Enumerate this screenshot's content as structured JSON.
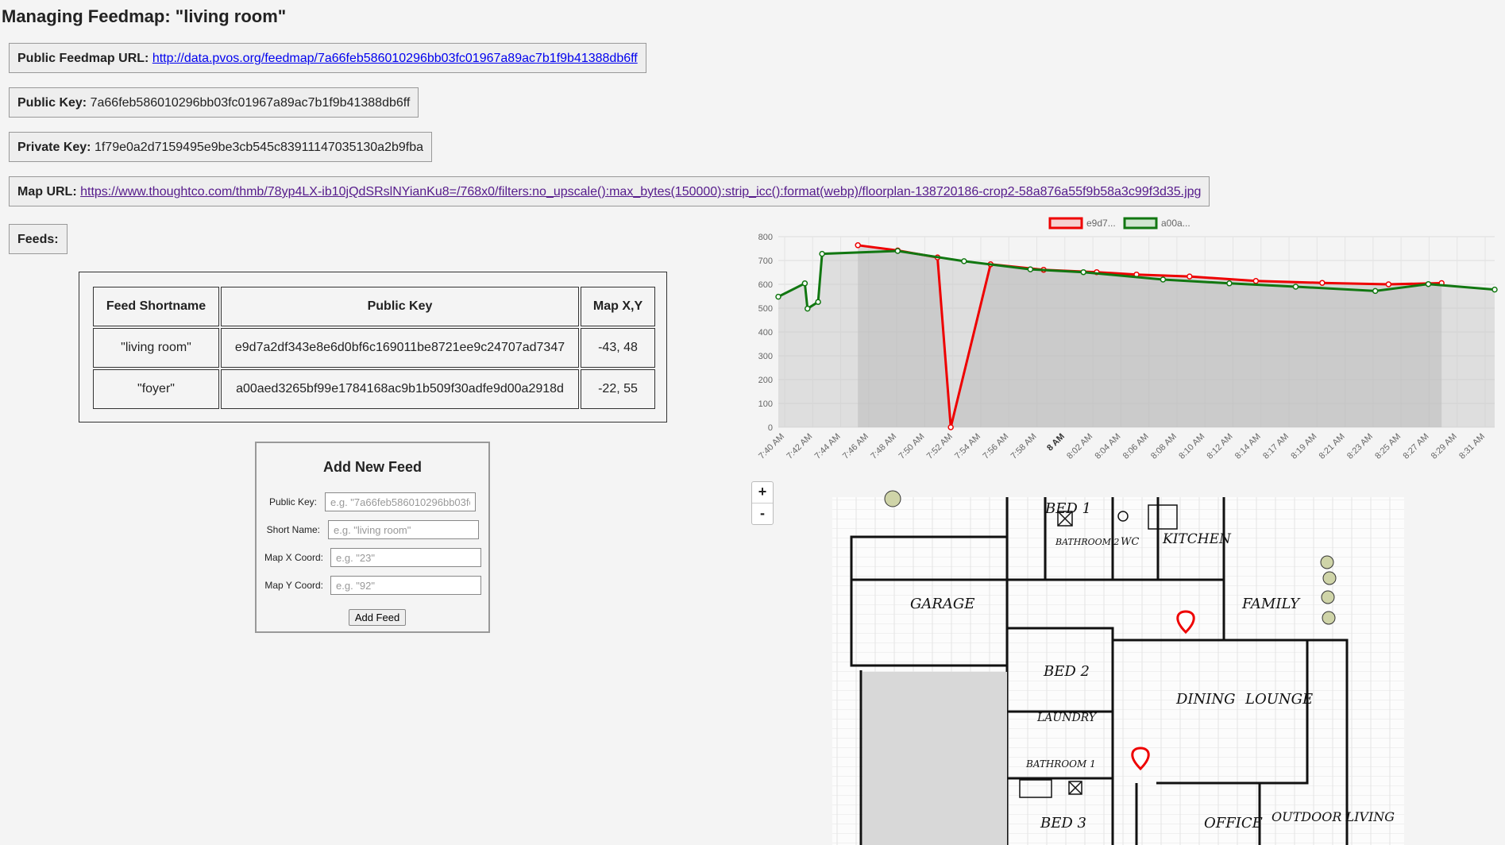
{
  "page_title": "Managing Feedmap: \"living room\"",
  "public_url": {
    "label": "Public Feedmap URL:",
    "value": "http://data.pvos.org/feedmap/7a66feb586010296bb03fc01967a89ac7b1f9b41388db6ff"
  },
  "public_key": {
    "label": "Public Key:",
    "value": "7a66feb586010296bb03fc01967a89ac7b1f9b41388db6ff"
  },
  "private_key": {
    "label": "Private Key:",
    "value": "1f79e0a2d7159495e9be3cb545c83911147035130a2b9fba"
  },
  "map_url": {
    "label": "Map URL:",
    "value": "https://www.thoughtco.com/thmb/78yp4LX-ib10jQdSRslNYianKu8=/768x0/filters:no_upscale():max_bytes(150000):strip_icc():format(webp)/floorplan-138720186-crop2-58a876a55f9b58a3c99f3d35.jpg"
  },
  "feeds_label": "Feeds:",
  "table": {
    "headers": [
      "Feed Shortname",
      "Public Key",
      "Map X,Y"
    ],
    "rows": [
      [
        "\"living room\"",
        "e9d7a2df343e8e6d0bf6c169011be8721ee9c24707ad7347",
        "-43, 48"
      ],
      [
        "\"foyer\"",
        "a00aed3265bf99e1784168ac9b1b509f30adfe9d00a2918d",
        "-22, 55"
      ]
    ]
  },
  "add_feed": {
    "title": "Add New Feed",
    "public_key_label": "Public Key:",
    "public_key_placeholder": "e.g. \"7a66feb586010296bb03fc01967a89ac7b1f9b41388db6ff\"",
    "short_name_label": "Short Name:",
    "short_name_placeholder": "e.g. \"living room\"",
    "x_label": "Map X Coord:",
    "x_placeholder": "e.g. \"23\"",
    "y_label": "Map Y Coord:",
    "y_placeholder": "e.g. \"92\"",
    "button": "Add Feed"
  },
  "map": {
    "zoom_in": "+",
    "zoom_out": "-",
    "rooms": [
      "BED 1",
      "BATHROOM 2",
      "WC",
      "KITCHEN",
      "GARAGE",
      "FAMILY",
      "BED 2",
      "DINING",
      "LOUNGE",
      "LAUNDRY",
      "BATHROOM 1",
      "BED 3",
      "OFFICE",
      "OUTDOOR LIVING"
    ]
  },
  "chart_data": {
    "type": "line",
    "ylim": [
      0,
      800
    ],
    "yticks": [
      0,
      100,
      200,
      300,
      400,
      500,
      600,
      700,
      800
    ],
    "x_range": [
      "7:39 AM",
      "8:33 AM"
    ],
    "xtick_labels": [
      "7:40 AM",
      "7:42 AM",
      "7:44 AM",
      "7:46 AM",
      "7:48 AM",
      "7:50 AM",
      "7:52 AM",
      "7:54 AM",
      "7:56 AM",
      "7:58 AM",
      "8 AM",
      "8:02 AM",
      "8:04 AM",
      "8:06 AM",
      "8:08 AM",
      "8:10 AM",
      "8:12 AM",
      "8:14 AM",
      "8:17 AM",
      "8:19 AM",
      "8:21 AM",
      "8:23 AM",
      "8:25 AM",
      "8:27 AM",
      "8:29 AM",
      "8:31 AM"
    ],
    "grid": true,
    "legend": "top-center",
    "series": [
      {
        "name": "e9d7...",
        "color": "#ee0000",
        "x": [
          "7:45 AM",
          "7:48 AM",
          "7:51 AM",
          "7:52 AM",
          "7:55 AM",
          "7:59 AM",
          "8:03 AM",
          "8:06 AM",
          "8:10 AM",
          "8:15 AM",
          "8:20 AM",
          "8:25 AM",
          "8:29 AM"
        ],
        "values": [
          764,
          742,
          713,
          0,
          684,
          661,
          651,
          641,
          633,
          614,
          606,
          600,
          605
        ]
      },
      {
        "name": "a00a...",
        "color": "#117711",
        "x": [
          "7:39 AM",
          "7:41 AM",
          "7:41.2 AM",
          "7:42 AM",
          "7:42.3 AM",
          "7:48 AM",
          "7:53 AM",
          "7:58 AM",
          "8:02 AM",
          "8:08 AM",
          "8:13 AM",
          "8:18 AM",
          "8:24 AM",
          "8:28 AM",
          "8:33 AM"
        ],
        "values": [
          548,
          604,
          498,
          526,
          728,
          740,
          697,
          663,
          651,
          620,
          604,
          590,
          572,
          601,
          578
        ]
      }
    ]
  }
}
